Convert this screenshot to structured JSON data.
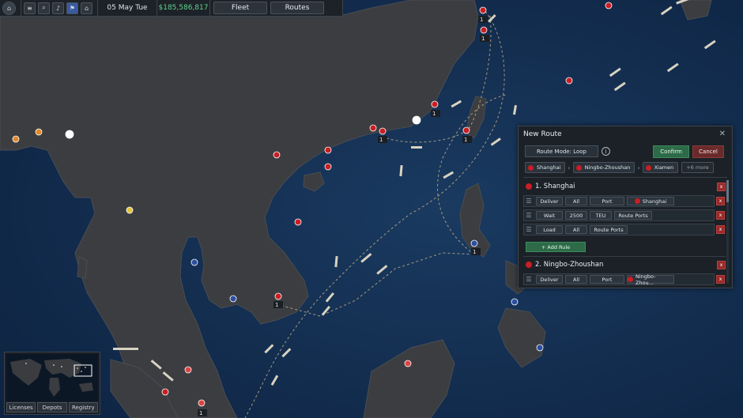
{
  "topbar": {
    "date": "05 May Tue",
    "money": "$185,586,817",
    "fleet_label": "Fleet",
    "routes_label": "Routes",
    "icons": [
      "home-icon",
      "menu-icon",
      "search-icon",
      "bell-icon",
      "flag-icon",
      "bank-icon"
    ]
  },
  "minimap": {
    "buttons": [
      "Licenses",
      "Depots",
      "Registry"
    ]
  },
  "map": {
    "colors": {
      "land": "#3a3c40",
      "sea": "#14304f",
      "route": "#c9b48a",
      "port": "#c81f24"
    },
    "ship_counts": [
      "1",
      "1",
      "1",
      "1",
      "1",
      "1",
      "1",
      "1"
    ]
  },
  "panel": {
    "title": "New Route",
    "mode_label": "Route Mode: Loop",
    "confirm_label": "Confirm",
    "cancel_label": "Cancel",
    "chips": [
      "Shanghai",
      "Ningbo-Zhoushan",
      "Xiamen"
    ],
    "more_label": "+6 more",
    "stops": [
      {
        "title": "1. Shanghai",
        "rules": [
          {
            "action": "Deliver",
            "qty": "All",
            "kind": "Port",
            "target": "Shanghai"
          },
          {
            "action": "Wait",
            "qty": "2500",
            "kind": "TEU",
            "target": "Route Ports"
          },
          {
            "action": "Load",
            "qty": "All",
            "kind": "Route Ports",
            "target": ""
          }
        ],
        "add_rule_label": "+ Add Rule"
      },
      {
        "title": "2. Ningbo-Zhoushan",
        "rules": [
          {
            "action": "Deliver",
            "qty": "All",
            "kind": "Port",
            "target": "Ningbo-Zhou..."
          }
        ]
      }
    ]
  }
}
